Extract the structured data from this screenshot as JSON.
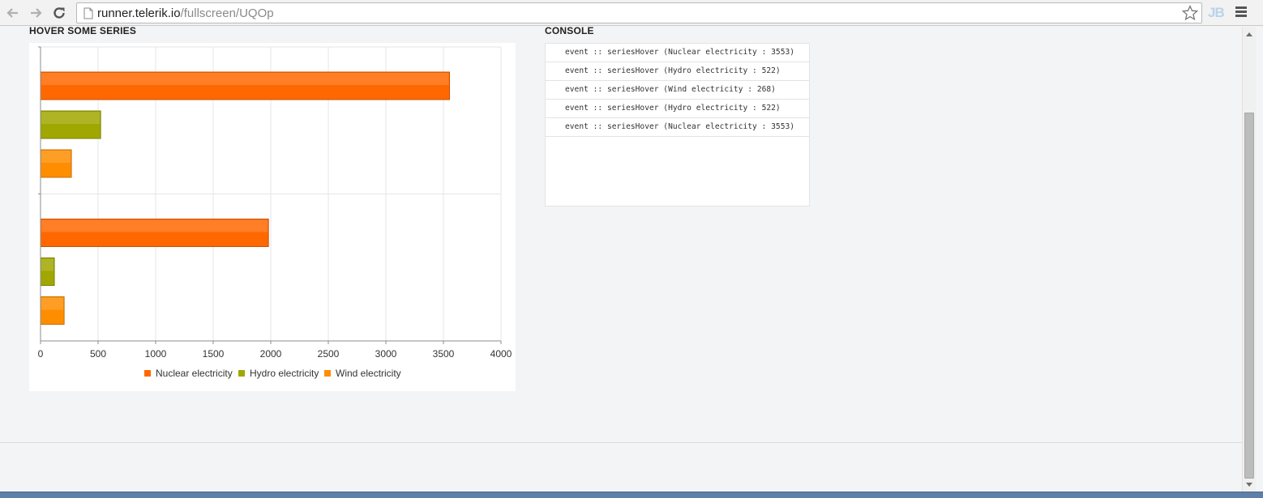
{
  "browser": {
    "url_host": "runner.telerik.io",
    "url_path": "/fullscreen/UQOp",
    "extension_label": "JB"
  },
  "sections": {
    "chart_title": "HOVER SOME SERIES",
    "console_title": "CONSOLE"
  },
  "console": {
    "lines": [
      "event :: seriesHover (Nuclear electricity : 3553)",
      "event :: seriesHover (Hydro electricity : 522)",
      "event :: seriesHover (Wind electricity : 268)",
      "event :: seriesHover (Hydro electricity : 522)",
      "event :: seriesHover (Nuclear electricity : 3553)"
    ]
  },
  "chart_data": {
    "type": "bar",
    "orientation": "horizontal",
    "categories": [
      "",
      ""
    ],
    "series": [
      {
        "name": "Nuclear electricity",
        "values": [
          3553,
          1980
        ],
        "color": "#ff6800"
      },
      {
        "name": "Hydro electricity",
        "values": [
          522,
          120
        ],
        "color": "#a0a700"
      },
      {
        "name": "Wind electricity",
        "values": [
          268,
          205
        ],
        "color": "#ff8d00"
      }
    ],
    "xlim": [
      0,
      4000
    ],
    "xticks": [
      0,
      500,
      1000,
      1500,
      2000,
      2500,
      3000,
      3500,
      4000
    ],
    "grid": true,
    "legend": "bottom"
  }
}
